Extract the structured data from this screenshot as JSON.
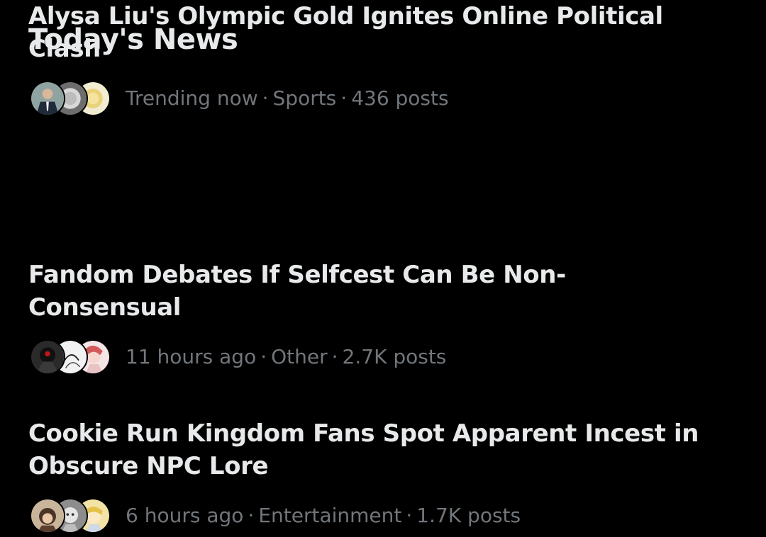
{
  "module": {
    "title": "Today's News"
  },
  "news": [
    {
      "headline": "Fandom Debates If Selfcest Can Be Non-Consensual",
      "headline_line1": "Fandom Debates If Selfcest Can Be Non-",
      "headline_line2": "Consensual",
      "time": "11 hours ago",
      "category": "Other",
      "posts": "2.7K posts",
      "avatars": [
        "dark-red-art-avatar",
        "white-sketch-avatar",
        "pink-anime-avatar"
      ]
    },
    {
      "headline": "Cookie Run Kingdom Fans Spot Apparent Incest in Obscure NPC Lore",
      "headline_line1": "Cookie Run Kingdom Fans Spot Apparent Incest in",
      "headline_line2": "Obscure NPC Lore",
      "time": "6 hours ago",
      "category": "Entertainment",
      "posts": "1.7K posts",
      "avatars": [
        "brown-character-avatar",
        "grey-character-avatar",
        "yellow-character-avatar"
      ]
    },
    {
      "headline": "Alysa Liu's Olympic Gold Ignites Online Political Clash",
      "headline_line1": "Alysa Liu's Olympic Gold Ignites Online Political",
      "headline_line2": "Clash",
      "time": "Trending now",
      "category": "Sports",
      "posts": "436 posts",
      "avatars": [
        "suit-person-avatar",
        "silver-medal-avatar",
        "gold-medal-avatar"
      ]
    }
  ],
  "meta_separator": "·",
  "colors": {
    "background": "#000000",
    "primary_text": "#e7e9ea",
    "secondary_text": "#71767b"
  }
}
